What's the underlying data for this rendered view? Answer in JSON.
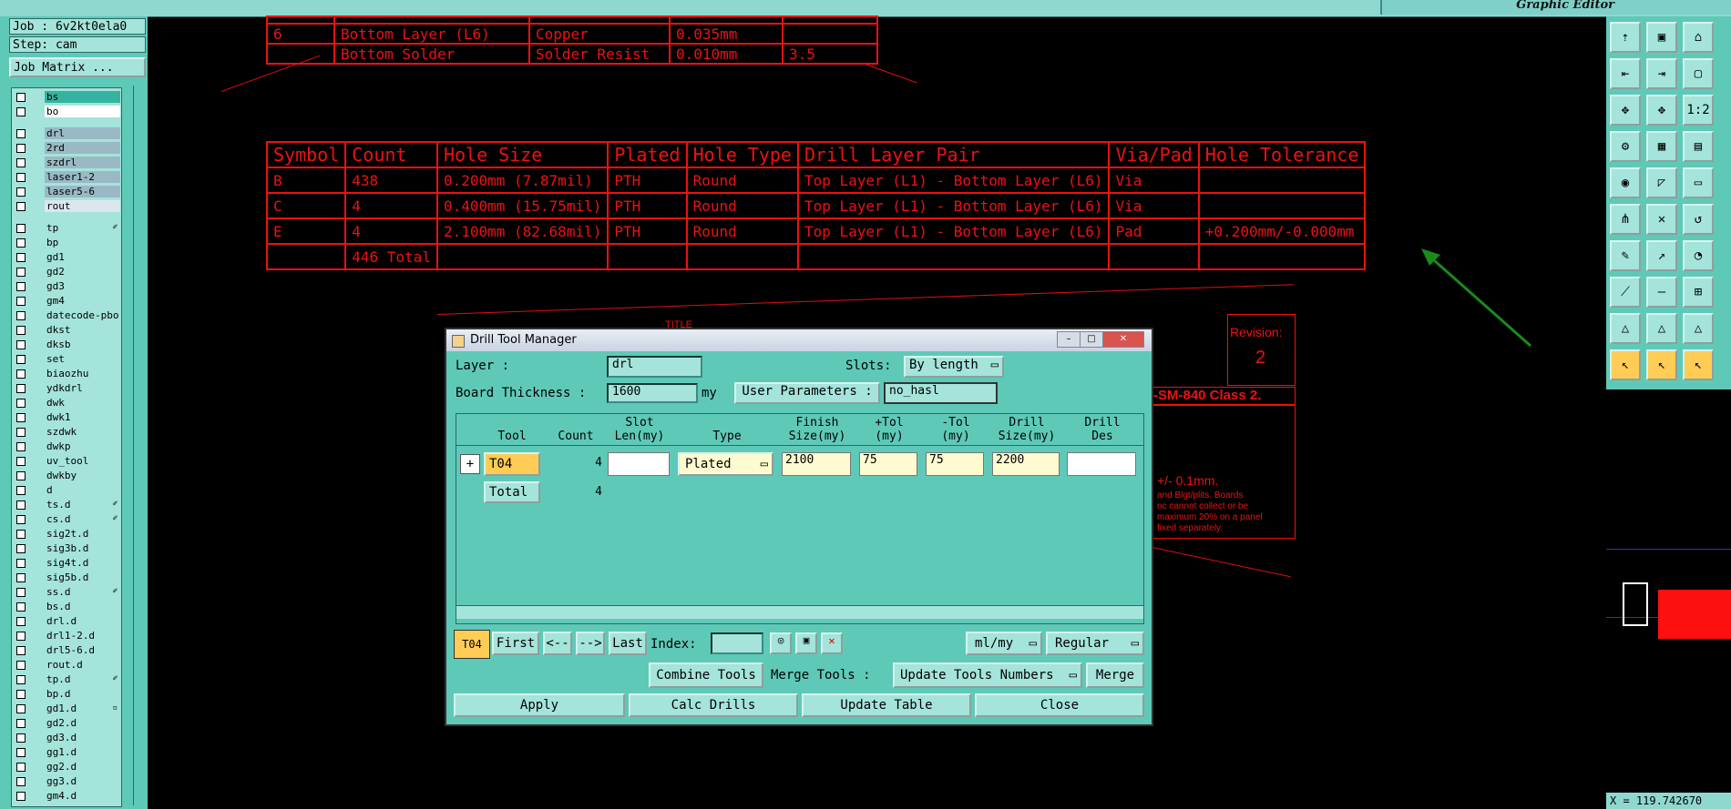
{
  "app": {
    "title": "Graphic Editor",
    "job": "Job : 6v2kt0ela0",
    "step": "Step: cam",
    "job_matrix": "Job Matrix ..."
  },
  "layers": [
    {
      "name": "bs",
      "color": "#36b3a0",
      "mark": ""
    },
    {
      "name": "bo",
      "color": "#ffffff",
      "mark": ""
    },
    {
      "name": "drl",
      "color": "#9ab9c4",
      "mark": ""
    },
    {
      "name": "2rd",
      "color": "#9ab9c4",
      "mark": ""
    },
    {
      "name": "szdrl",
      "color": "#9ab9c4",
      "mark": ""
    },
    {
      "name": "laser1-2",
      "color": "#9ab9c4",
      "mark": ""
    },
    {
      "name": "laser5-6",
      "color": "#9ab9c4",
      "mark": ""
    },
    {
      "name": "rout",
      "color": "#dde6ee",
      "mark": ""
    },
    {
      "name": "tp",
      "color": "#a4e4da",
      "mark": "✐"
    },
    {
      "name": "bp",
      "color": "#a4e4da",
      "mark": ""
    },
    {
      "name": "gd1",
      "color": "#a4e4da",
      "mark": ""
    },
    {
      "name": "gd2",
      "color": "#a4e4da",
      "mark": ""
    },
    {
      "name": "gd3",
      "color": "#a4e4da",
      "mark": ""
    },
    {
      "name": "gm4",
      "color": "#a4e4da",
      "mark": ""
    },
    {
      "name": "datecode-pbo",
      "color": "#a4e4da",
      "mark": ""
    },
    {
      "name": "dkst",
      "color": "#a4e4da",
      "mark": ""
    },
    {
      "name": "dksb",
      "color": "#a4e4da",
      "mark": ""
    },
    {
      "name": "set",
      "color": "#a4e4da",
      "mark": ""
    },
    {
      "name": "biaozhu",
      "color": "#a4e4da",
      "mark": ""
    },
    {
      "name": "ydkdrl",
      "color": "#a4e4da",
      "mark": ""
    },
    {
      "name": "dwk",
      "color": "#a4e4da",
      "mark": ""
    },
    {
      "name": "dwk1",
      "color": "#a4e4da",
      "mark": ""
    },
    {
      "name": "szdwk",
      "color": "#a4e4da",
      "mark": ""
    },
    {
      "name": "dwkp",
      "color": "#a4e4da",
      "mark": ""
    },
    {
      "name": "uv_tool",
      "color": "#a4e4da",
      "mark": ""
    },
    {
      "name": "dwkby",
      "color": "#a4e4da",
      "mark": ""
    },
    {
      "name": "d",
      "color": "#a4e4da",
      "mark": ""
    },
    {
      "name": "ts.d",
      "color": "#a4e4da",
      "mark": "✐"
    },
    {
      "name": "cs.d",
      "color": "#a4e4da",
      "mark": "✐"
    },
    {
      "name": "sig2t.d",
      "color": "#a4e4da",
      "mark": ""
    },
    {
      "name": "sig3b.d",
      "color": "#a4e4da",
      "mark": ""
    },
    {
      "name": "sig4t.d",
      "color": "#a4e4da",
      "mark": ""
    },
    {
      "name": "sig5b.d",
      "color": "#a4e4da",
      "mark": ""
    },
    {
      "name": "ss.d",
      "color": "#a4e4da",
      "mark": "✐"
    },
    {
      "name": "bs.d",
      "color": "#a4e4da",
      "mark": ""
    },
    {
      "name": "drl.d",
      "color": "#a4e4da",
      "mark": ""
    },
    {
      "name": "drl1-2.d",
      "color": "#a4e4da",
      "mark": ""
    },
    {
      "name": "drl5-6.d",
      "color": "#a4e4da",
      "mark": ""
    },
    {
      "name": "rout.d",
      "color": "#a4e4da",
      "mark": ""
    },
    {
      "name": "tp.d",
      "color": "#a4e4da",
      "mark": "✐"
    },
    {
      "name": "bp.d",
      "color": "#a4e4da",
      "mark": ""
    },
    {
      "name": "gd1.d",
      "color": "#a4e4da",
      "mark": "▫"
    },
    {
      "name": "gd2.d",
      "color": "#a4e4da",
      "mark": ""
    },
    {
      "name": "gd3.d",
      "color": "#a4e4da",
      "mark": ""
    },
    {
      "name": "gg1.d",
      "color": "#a4e4da",
      "mark": ""
    },
    {
      "name": "gg2.d",
      "color": "#a4e4da",
      "mark": ""
    },
    {
      "name": "gg3.d",
      "color": "#a4e4da",
      "mark": ""
    },
    {
      "name": "gm4.d",
      "color": "#a4e4da",
      "mark": ""
    }
  ],
  "stackup": {
    "rows": [
      [
        "6",
        "Bottom Layer (L6)",
        "Copper",
        "0.035mm",
        ""
      ],
      [
        "",
        "Bottom Solder",
        "Solder Resist",
        "0.010mm",
        "3.5"
      ]
    ]
  },
  "drilltable": {
    "headers": [
      "Symbol",
      "Count",
      "Hole Size",
      "Plated",
      "Hole Type",
      "Drill Layer Pair",
      "Via/Pad",
      "Hole Tolerance"
    ],
    "rows": [
      [
        "B",
        "438",
        "0.200mm (7.87mil)",
        "PTH",
        "Round",
        "Top Layer (L1) - Bottom Layer (L6)",
        "Via",
        ""
      ],
      [
        "C",
        "4",
        "0.400mm (15.75mil)",
        "PTH",
        "Round",
        "Top Layer (L1) - Bottom Layer (L6)",
        "Via",
        ""
      ],
      [
        "E",
        "4",
        "2.100mm (82.68mil)",
        "PTH",
        "Round",
        "Top Layer (L1) - Bottom Layer (L6)",
        "Pad",
        "+0.200mm/-0.000mm"
      ],
      [
        "",
        "446 Total",
        "",
        "",
        "",
        "",
        "",
        ""
      ]
    ]
  },
  "titleblock": {
    "revision_label": "Revision:",
    "revision": "2",
    "title_label": "TITLE",
    "standard": "-SM-840 Class 2.",
    "tol": "+/- 0.1mm.",
    "note1": "and Blgt/plits. Boards",
    "note2": "nc cannot collect or be",
    "note3": "maximum 20% on a panel",
    "note4": "fixed separately."
  },
  "dialog": {
    "title": "Drill Tool Manager",
    "layer_label": "Layer            :",
    "layer_value": "drl",
    "slots_label": "Slots:",
    "slots_value": "By length",
    "thickness_label": "Board Thickness :",
    "thickness_value": "1600",
    "thickness_unit": "my",
    "userparams_label": "User Parameters :",
    "userparams_value": "no_hasl",
    "columns": [
      {
        "l1": "",
        "l2": "Tool"
      },
      {
        "l1": "",
        "l2": "Count"
      },
      {
        "l1": "Slot",
        "l2": "Len(my)"
      },
      {
        "l1": "",
        "l2": "Type"
      },
      {
        "l1": "Finish",
        "l2": "Size(my)"
      },
      {
        "l1": "+Tol",
        "l2": "(my)"
      },
      {
        "l1": "-Tol",
        "l2": "(my)"
      },
      {
        "l1": "Drill",
        "l2": "Size(my)"
      },
      {
        "l1": "Drill",
        "l2": "Des"
      }
    ],
    "row": {
      "tool": "T04",
      "count": "4",
      "slot": "",
      "type": "Plated",
      "finish": "2100",
      "ptol": "75",
      "mtol": "75",
      "drill": "2200",
      "des": ""
    },
    "total_label": "Total",
    "total_count": "4",
    "current_tool": "T04",
    "first": "First",
    "prev": "<--",
    "next": "-->",
    "last": "Last",
    "index_label": "Index:",
    "units": "ml/my",
    "mode": "Regular",
    "combine": "Combine Tools",
    "merge_label": "Merge Tools :",
    "update_numbers": "Update Tools Numbers",
    "merge": "Merge",
    "apply": "Apply",
    "calc": "Calc Drills",
    "update_table": "Update Table",
    "close": "Close"
  },
  "status": {
    "coord": "X = 119.742670"
  },
  "colors": {
    "canvas": "#000000",
    "panel": "#5fc9b8",
    "field": "#a4e4da",
    "drawing": "#e01010",
    "highlight": "#ffcc55",
    "arrow": "#1a8a1a"
  }
}
